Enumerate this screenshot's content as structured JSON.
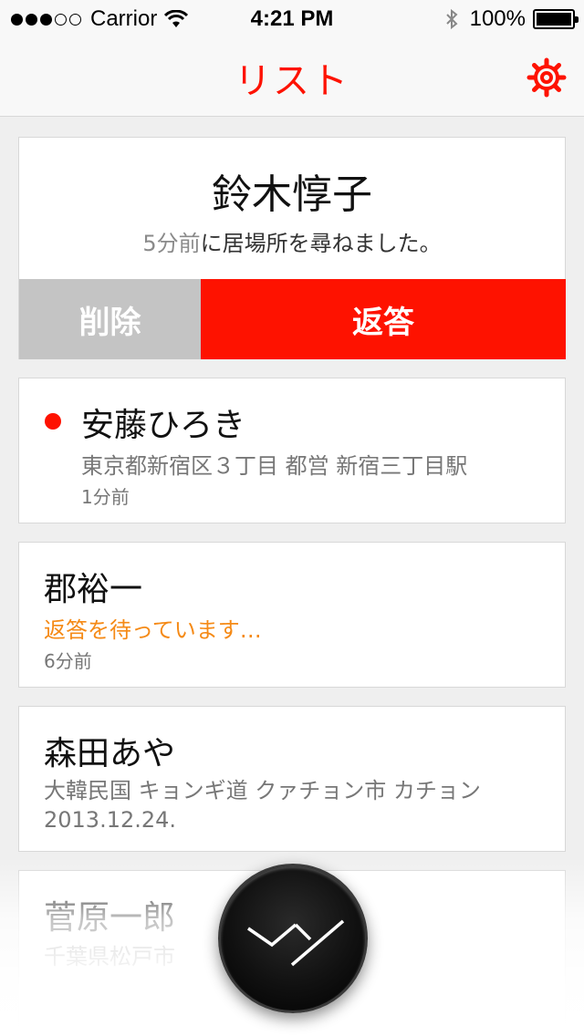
{
  "status_bar": {
    "carrier": "Carrior",
    "time": "4:21 PM",
    "battery": "100%"
  },
  "nav": {
    "title": "リスト",
    "settings_icon": "gear-icon"
  },
  "colors": {
    "accent": "#fe1200",
    "waiting": "#f58a16",
    "delete_bg": "#c4c4c4"
  },
  "expanded_request": {
    "name": "鈴木惇子",
    "ago": "5分前",
    "message": "に居場所を尋ねました。",
    "delete_label": "削除",
    "reply_label": "返答"
  },
  "contacts": [
    {
      "name": "安藤ひろき",
      "location": "東京都新宿区３丁目 都営 新宿三丁目駅",
      "time": "1分前",
      "unread": true
    },
    {
      "name": "郡裕一",
      "status": "返答を待っています…",
      "time": "6分前"
    },
    {
      "name": "森田あや",
      "location": "大韓民国 キョンギ道 クァチョン市 カチョン",
      "time": "2013.12.24."
    },
    {
      "name": "菅原一郎",
      "location": "千葉県松戸市"
    }
  ],
  "fab": {
    "icon": "logo-icon"
  }
}
